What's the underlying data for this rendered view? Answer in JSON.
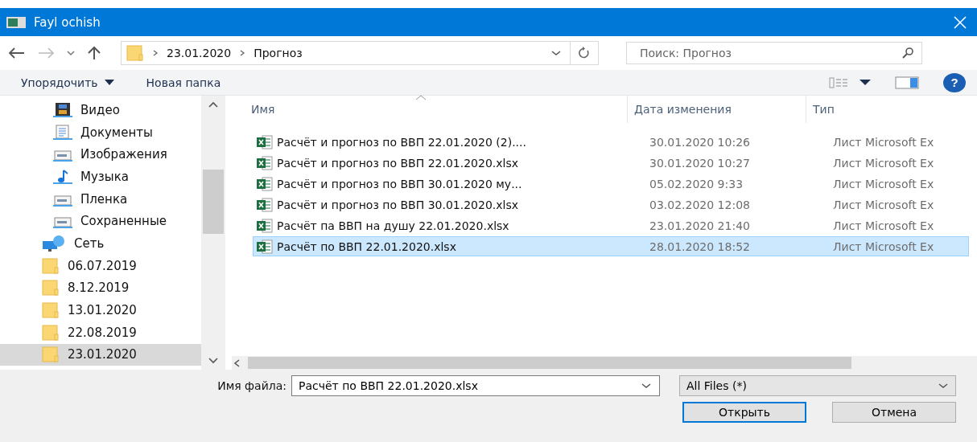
{
  "window": {
    "title": "Fayl ochish"
  },
  "breadcrumb": [
    "23.01.2020",
    "Прогноз"
  ],
  "search": {
    "placeholder": "Поиск: Прогноз"
  },
  "toolbar": {
    "organize": "Упорядочить",
    "new_folder": "Новая папка",
    "help": "?"
  },
  "sidebar": {
    "items": [
      {
        "label": "Видео",
        "kind": "video",
        "selected": false
      },
      {
        "label": "Документы",
        "kind": "docs",
        "selected": false
      },
      {
        "label": "Изображения",
        "kind": "pics",
        "selected": false
      },
      {
        "label": "Музыка",
        "kind": "music",
        "selected": false
      },
      {
        "label": "Пленка",
        "kind": "pics",
        "selected": false
      },
      {
        "label": "Сохраненные",
        "kind": "pics",
        "selected": false
      },
      {
        "label": "Сеть",
        "kind": "network",
        "selected": false
      },
      {
        "label": "06.07.2019",
        "kind": "folder",
        "selected": false
      },
      {
        "label": "8.12.2019",
        "kind": "folder",
        "selected": false
      },
      {
        "label": "13.01.2020",
        "kind": "folder",
        "selected": false
      },
      {
        "label": "22.08.2019",
        "kind": "folder",
        "selected": false
      },
      {
        "label": "23.01.2020",
        "kind": "folder",
        "selected": true
      }
    ]
  },
  "table": {
    "columns": [
      "Имя",
      "Дата изменения",
      "Тип"
    ],
    "rows": [
      {
        "name": "Расчёт и прогноз по ВВП 22.01.2020 (2)....",
        "date": "30.01.2020 10:26",
        "type": "Лист Microsoft Ex",
        "selected": false
      },
      {
        "name": "Расчёт и прогноз по ВВП 22.01.2020.xlsx",
        "date": "30.01.2020 10:27",
        "type": "Лист Microsoft Ex",
        "selected": false
      },
      {
        "name": "Расчёт и прогноз по ВВП 30.01.2020 му...",
        "date": "05.02.2020 9:33",
        "type": "Лист Microsoft Ex",
        "selected": false
      },
      {
        "name": "Расчёт и прогноз по ВВП 30.01.2020.xlsx",
        "date": "03.02.2020 12:08",
        "type": "Лист Microsoft Ex",
        "selected": false
      },
      {
        "name": "Расчёт па ВВП на душу 22.01.2020.xlsx",
        "date": "23.01.2020 21:40",
        "type": "Лист Microsoft Ex",
        "selected": false
      },
      {
        "name": "Расчёт по ВВП 22.01.2020.xlsx",
        "date": "28.01.2020 18:52",
        "type": "Лист Microsoft Ex",
        "selected": true
      }
    ]
  },
  "footer": {
    "filename_label": "Имя файла:",
    "filename_value": "Расчёт по ВВП 22.01.2020.xlsx",
    "filter": "All Files  (*)",
    "open": "Открыть",
    "cancel": "Отмена"
  }
}
